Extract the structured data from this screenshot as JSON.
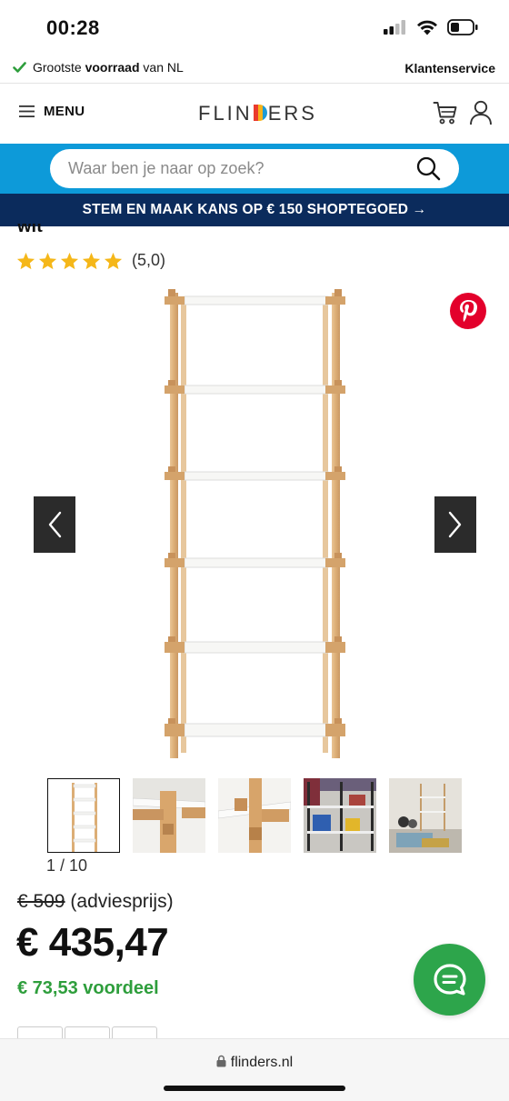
{
  "status_bar": {
    "time": "00:28",
    "battery_level": 0.4
  },
  "usp_bar": {
    "usp_prefix": "Grootste ",
    "usp_bold": "voorraad",
    "usp_suffix": " van NL",
    "service_link": "Klantenservice"
  },
  "header": {
    "menu_label": "MENU",
    "logo_before": "FLIN",
    "logo_after": "ERS"
  },
  "search": {
    "placeholder": "Waar ben je naar op zoek?"
  },
  "promo": {
    "text": "STEM EN MAAK KANS OP € 150 SHOPTEGOED →"
  },
  "product": {
    "title_fragment": "wit",
    "rating": {
      "stars": 5,
      "max_stars": 5,
      "label": "(5,0)"
    },
    "gallery": {
      "current": 1,
      "total": 10,
      "counter_text": "1 / 10",
      "thumbnails": [
        "thumb-1",
        "thumb-2",
        "thumb-3",
        "thumb-4",
        "thumb-5"
      ]
    },
    "price": {
      "old": "€ 509",
      "old_suffix": " (adviesprijs)",
      "current": "€ 435,47",
      "savings": "€ 73,53 voordeel"
    }
  },
  "browser": {
    "url": "flinders.nl"
  },
  "colors": {
    "search_band": "#0d9ad9",
    "promo_bg": "#0b2b5c",
    "savings": "#2e9e3c",
    "chat": "#2da54b",
    "star": "#f5b719",
    "pinterest": "#e3002b"
  }
}
